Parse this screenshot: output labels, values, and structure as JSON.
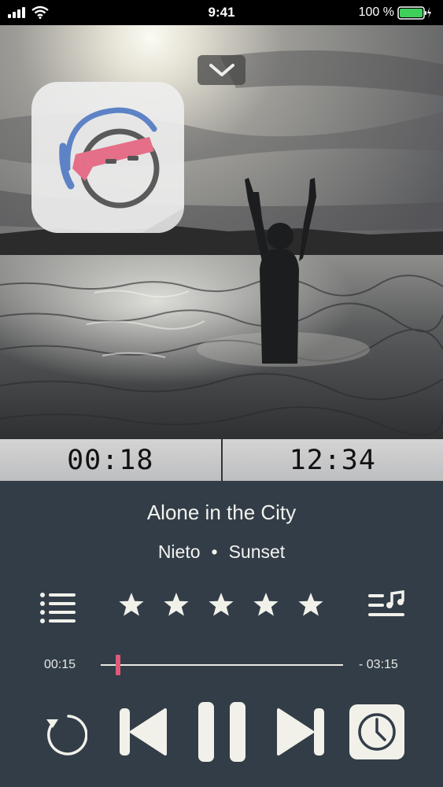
{
  "status_bar": {
    "time": "9:41",
    "battery_text": "100 %",
    "battery_color": "#3fd05c"
  },
  "artwork": {
    "collapse_icon": "chevron-down-icon",
    "logo_icon": "headphones-face-icon"
  },
  "time_bar": {
    "left_time": "00:18",
    "right_time": "12:34"
  },
  "track": {
    "title": "Alone in the City",
    "artist": "Nieto",
    "separator": "•",
    "album": "Sunset"
  },
  "controls": {
    "list_icon": "list-icon",
    "queue_icon": "music-queue-icon",
    "rating": 5,
    "rating_max": 5,
    "elapsed": "00:15",
    "remaining": "- 03:15",
    "progress_fraction": 0.07,
    "repeat_icon": "repeat-icon",
    "prev_icon": "skip-back-icon",
    "play_pause_icon": "pause-icon",
    "next_icon": "skip-forward-icon",
    "timer_icon": "clock-icon"
  },
  "colors": {
    "panel_bg": "#323d48",
    "accent": "#e05a78",
    "control_fg": "#f1f1ea"
  }
}
